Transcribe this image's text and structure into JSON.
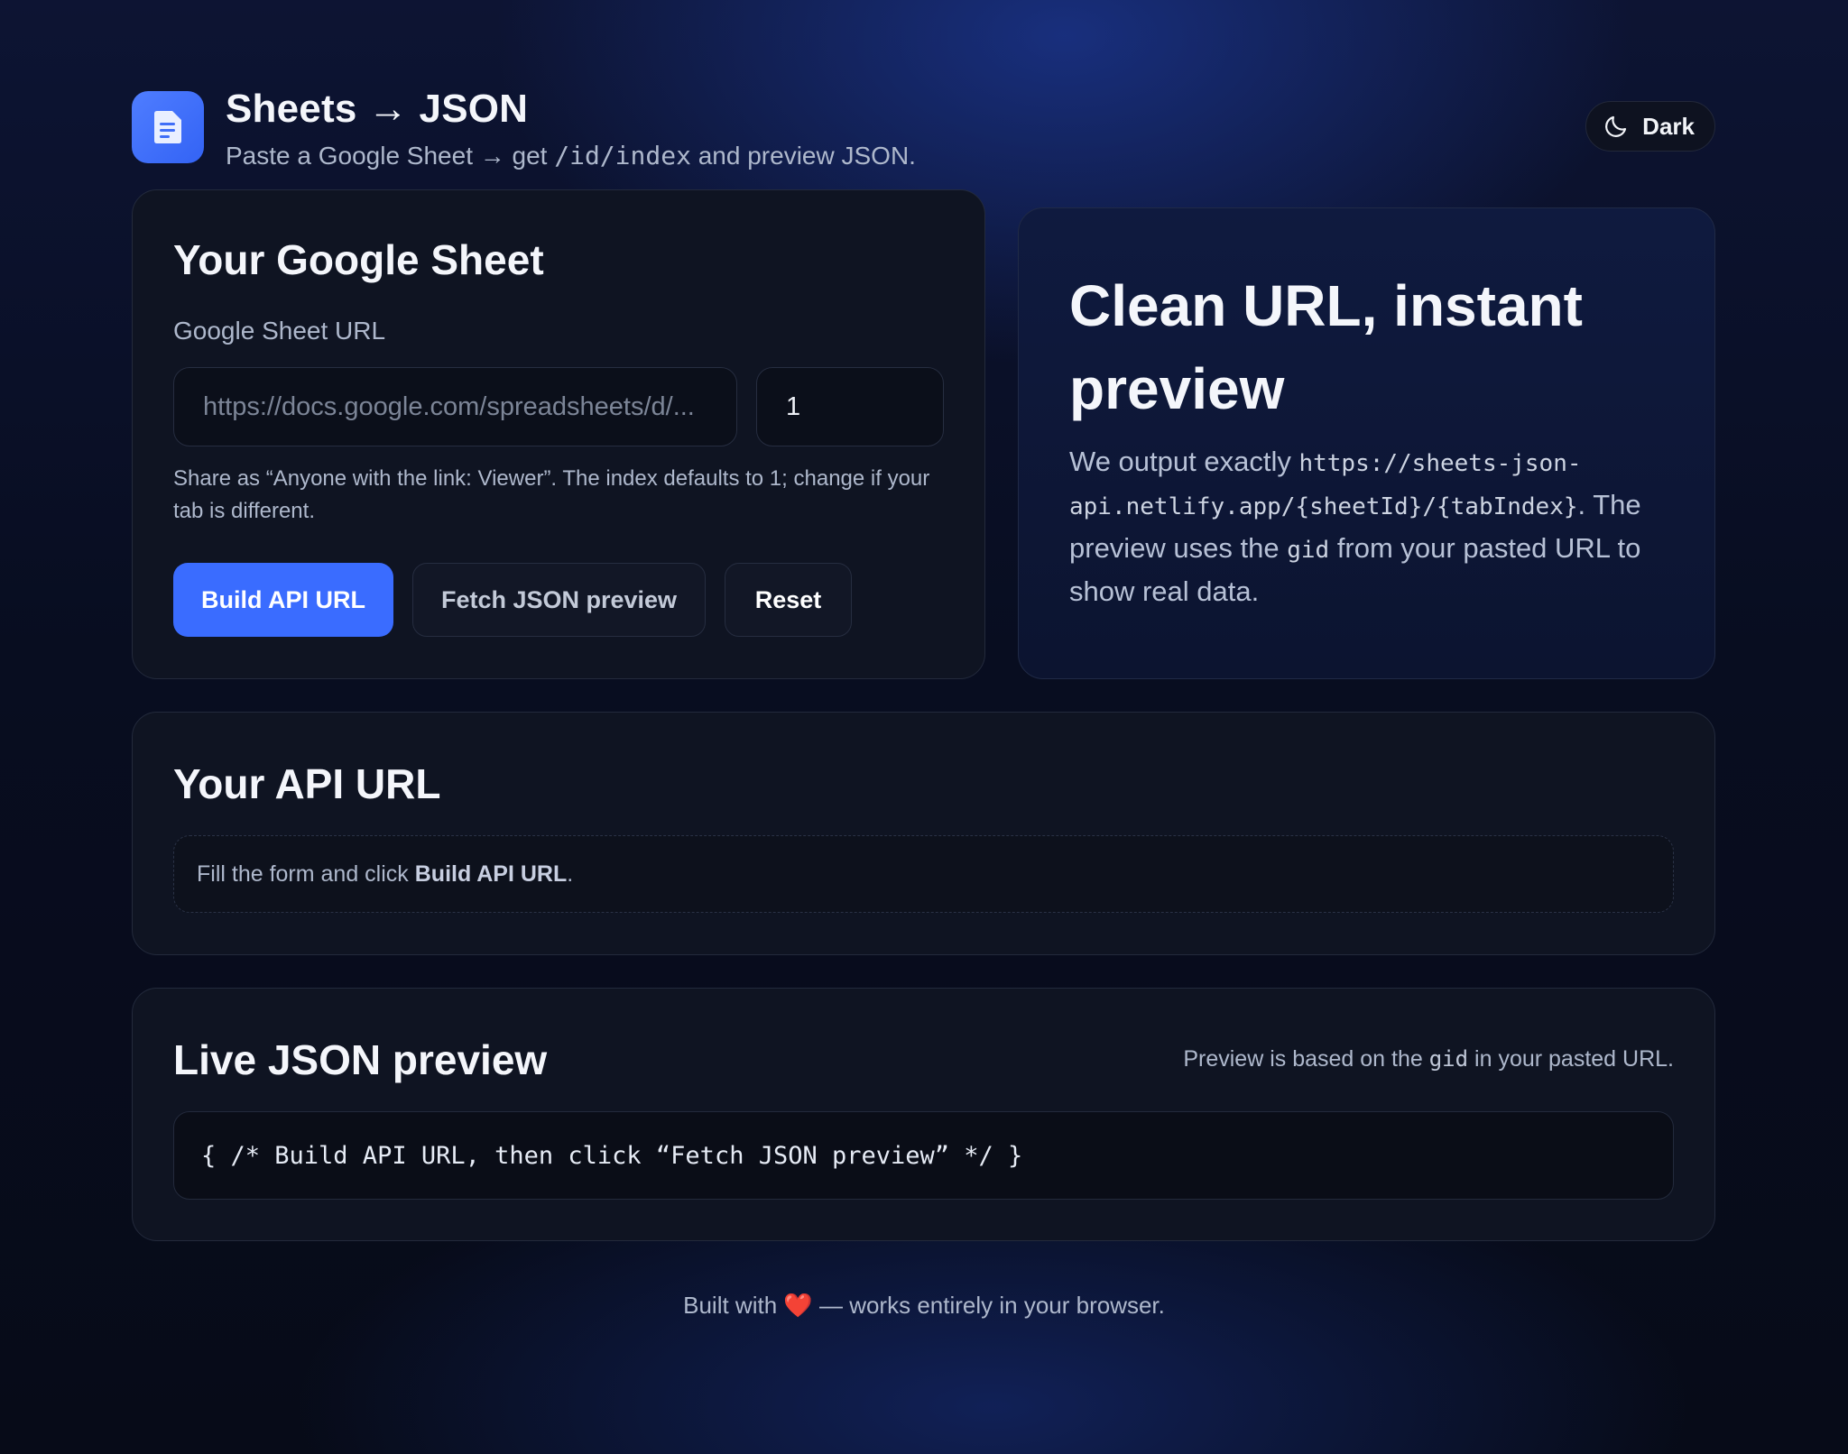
{
  "header": {
    "title": "Sheets → JSON",
    "subtitle_pre": "Paste a Google Sheet → get ",
    "subtitle_code": "/id/index",
    "subtitle_post": " and preview JSON.",
    "theme_label": "Dark",
    "logo_icon": "document-icon",
    "theme_icon": "moon-icon"
  },
  "sheet_card": {
    "heading": "Your Google Sheet",
    "url_label": "Google Sheet URL",
    "url_placeholder": "https://docs.google.com/spreadsheets/d/...",
    "url_value": "",
    "index_value": "1",
    "hint": "Share as “Anyone with the link: Viewer”. The index defaults to 1; change if your tab is different.",
    "build_label": "Build API URL",
    "fetch_label": "Fetch JSON preview",
    "reset_label": "Reset"
  },
  "info_card": {
    "title": "Clean URL, instant preview",
    "body_1": "We output exactly ",
    "body_code_1": "https://sheets-json-api.netlify.app/{sheetId}/{tabIndex}",
    "body_2": ". The preview uses the ",
    "body_code_2": "gid",
    "body_3": " from your pasted URL to show real data."
  },
  "api_card": {
    "heading": "Your API URL",
    "empty_pre": "Fill the form and click ",
    "empty_bold": "Build API URL",
    "empty_post": "."
  },
  "preview_card": {
    "heading": "Live JSON preview",
    "note_pre": "Preview is based on the ",
    "note_code": "gid",
    "note_post": " in your pasted URL.",
    "code": "{ /* Build API URL, then click “Fetch JSON preview” */ }"
  },
  "footer": {
    "pre": "Built with ",
    "heart": "❤️",
    "post": " — works entirely in your browser."
  },
  "colors": {
    "accent": "#3a6cff",
    "background": "#080d20",
    "card": "#0f1422"
  }
}
